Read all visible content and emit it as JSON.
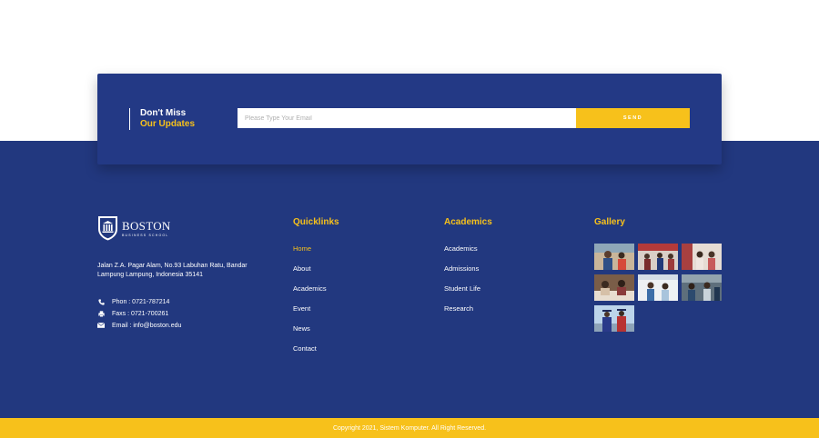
{
  "newsletter": {
    "heading_line1": "Don't Miss",
    "heading_line2": "Our Updates",
    "email_placeholder": "Please Type Your Email",
    "send_label": "SEND"
  },
  "brand": {
    "name": "BOSTON",
    "subtitle": "BUSINESS SCHOOL"
  },
  "contact": {
    "address": "Jalan Z.A. Pagar Alam, No.93 Labuhan Ratu, Bandar Lampung Lampung, Indonesia 35141",
    "phone": "Phon : 0721-787214",
    "fax": "Faxs : 0721-700261",
    "email": "Email : info@boston.edu"
  },
  "quicklinks": {
    "title": "Quicklinks",
    "items": [
      "Home",
      "About",
      "Academics",
      "Event",
      "News",
      "Contact"
    ]
  },
  "academics": {
    "title": "Academics",
    "items": [
      "Academics",
      "Admissions",
      "Student Life",
      "Research"
    ]
  },
  "gallery": {
    "title": "Gallery"
  },
  "copyright": "Copyright 2021, Sistem Komputer. All Right Reserved.",
  "colors": {
    "navy": "#22387f",
    "accent_yellow": "#f7c11b",
    "white": "#ffffff"
  }
}
